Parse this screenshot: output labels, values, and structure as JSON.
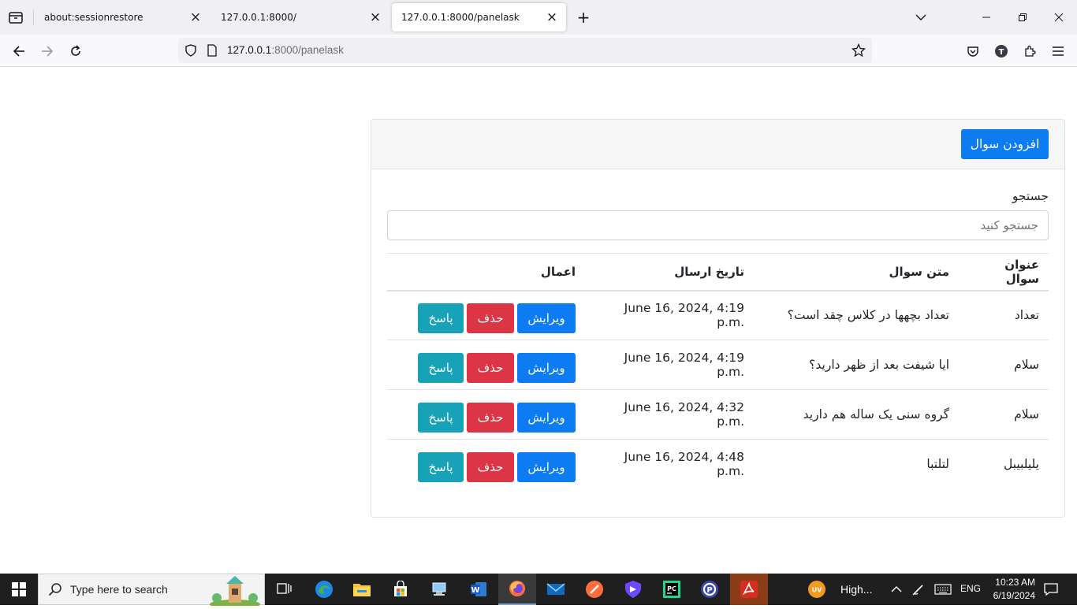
{
  "browser": {
    "tabs": [
      {
        "title": "about:sessionrestore"
      },
      {
        "title": "127.0.0.1:8000/"
      },
      {
        "title": "127.0.0.1:8000/panelask"
      }
    ],
    "url_host": "127.0.0.1",
    "url_path": ":8000/panelask"
  },
  "page": {
    "add_button": "افزودن سوال",
    "search_label": "جستجو",
    "search_placeholder": "جستجو کنید",
    "table": {
      "headers": [
        "عنوان سوال",
        "متن سوال",
        "تاریخ ارسال",
        "اعمال"
      ],
      "rows": [
        {
          "title": "تعداد",
          "text": "تعداد بچهها در کلاس چقد است؟",
          "date": "June 16, 2024, 4:19 p.m."
        },
        {
          "title": "سلام",
          "text": "ایا شیفت بعد از ظهر دارید؟",
          "date": "June 16, 2024, 4:19 p.m."
        },
        {
          "title": "سلام",
          "text": "گروه سنی یک ساله هم دارید",
          "date": "June 16, 2024, 4:32 p.m."
        },
        {
          "title": "یلیلبیبل",
          "text": "لتلتبا",
          "date": "June 16, 2024, 4:48 p.m."
        }
      ],
      "actions": {
        "edit": "ویرایش",
        "delete": "حذف",
        "answer": "پاسخ"
      }
    }
  },
  "taskbar": {
    "search_placeholder": "Type here to search",
    "weather": "High...",
    "weather_badge": "UV",
    "language": "ENG",
    "time": "10:23 AM",
    "date": "6/19/2024"
  }
}
